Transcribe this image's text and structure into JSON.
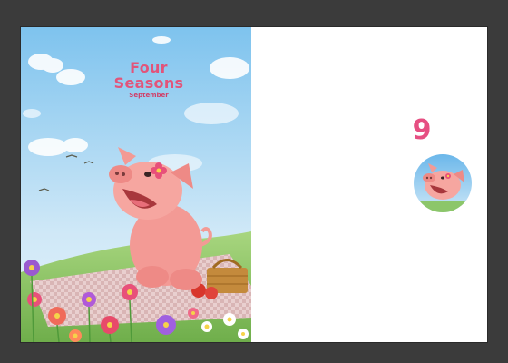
{
  "calendar": {
    "title_line1": "Four",
    "title_line2": "Seasons",
    "subtitle": "September",
    "month_number": "9"
  },
  "colors": {
    "background": "#3b3b3b",
    "sky_top": "#7ec3ee",
    "sky_bottom": "#cfe8f7",
    "grass": "#8cc66a",
    "pig": "#f39a95",
    "title": "#e2547a",
    "number": "#e64f82"
  },
  "icons": [
    "pig-thumbnail-icon"
  ]
}
